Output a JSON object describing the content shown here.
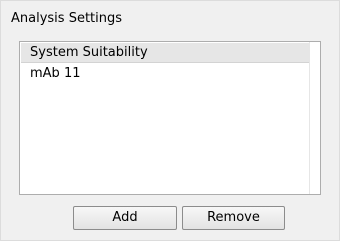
{
  "panel": {
    "title": "Analysis Settings"
  },
  "list": {
    "items": [
      {
        "label": "System Suitability",
        "selected": true
      },
      {
        "label": "mAb 11",
        "selected": false
      }
    ]
  },
  "buttons": {
    "add_label": "Add",
    "remove_label": "Remove"
  }
}
